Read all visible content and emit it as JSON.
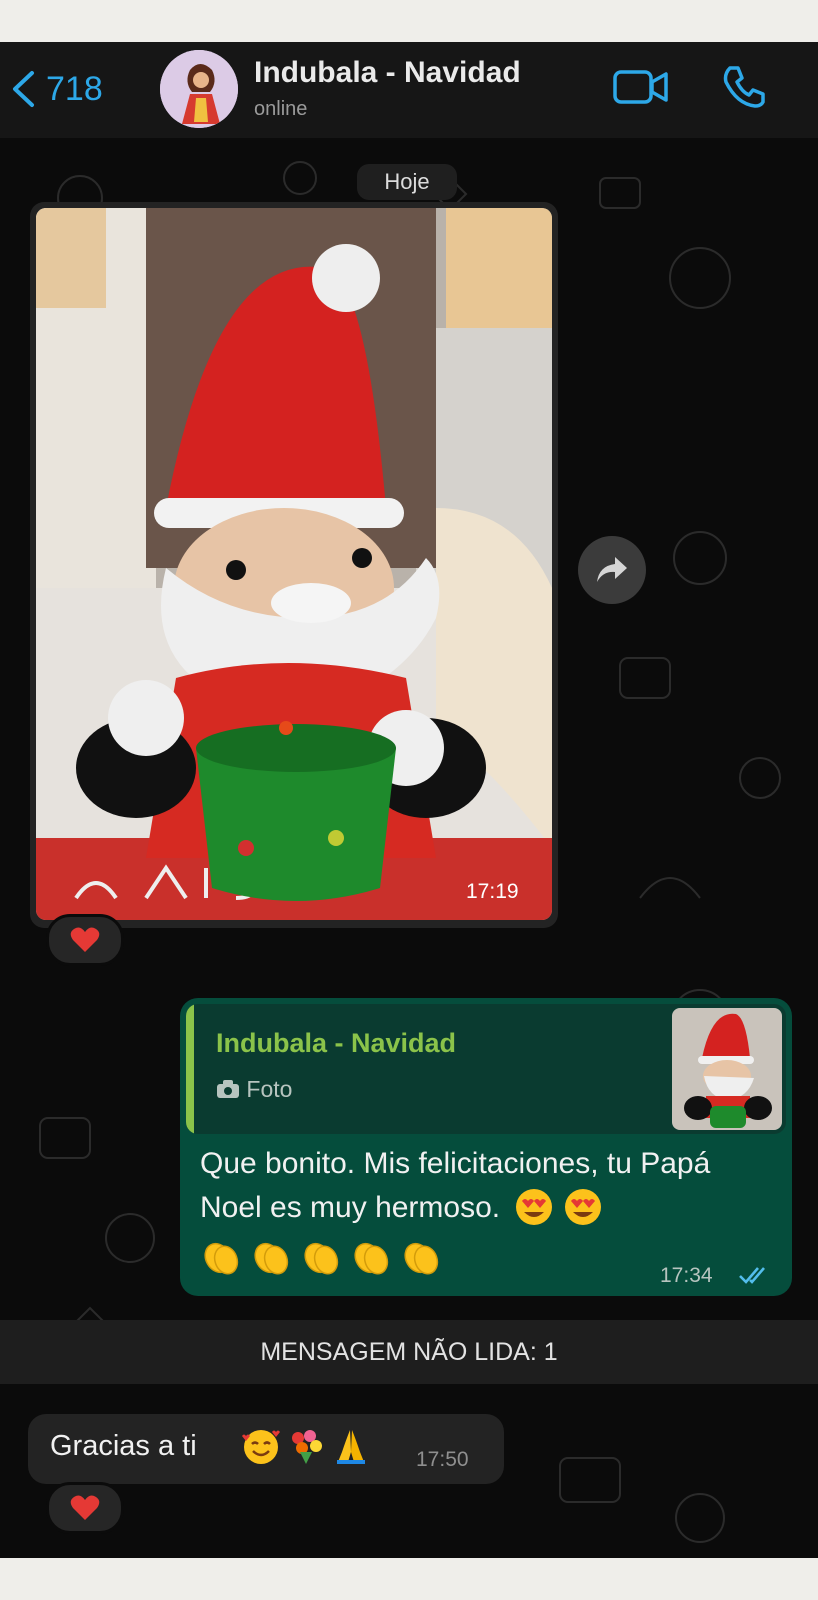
{
  "header": {
    "back_count": "718",
    "contact_name": "Indubala - Navidad",
    "status": "online"
  },
  "chat": {
    "date_chip": "Hoje",
    "photo_message": {
      "time": "17:19",
      "reaction": "heart"
    },
    "reply_message": {
      "quoted_author": "Indubala - Navidad",
      "quoted_type": "Foto",
      "text": "Que bonito. Mis felicitaciones, tu Papá Noel es muy hermoso.",
      "time": "17:34",
      "read": true
    },
    "unread_banner": "MENSAGEM NÃO LIDA: 1",
    "incoming_message": {
      "text": "Gracias  a ti",
      "time": "17:50",
      "reaction": "heart"
    }
  },
  "colors": {
    "accent": "#2da8e8",
    "outgoing_bubble": "#054d3c",
    "quote_green": "#8bc34a"
  }
}
